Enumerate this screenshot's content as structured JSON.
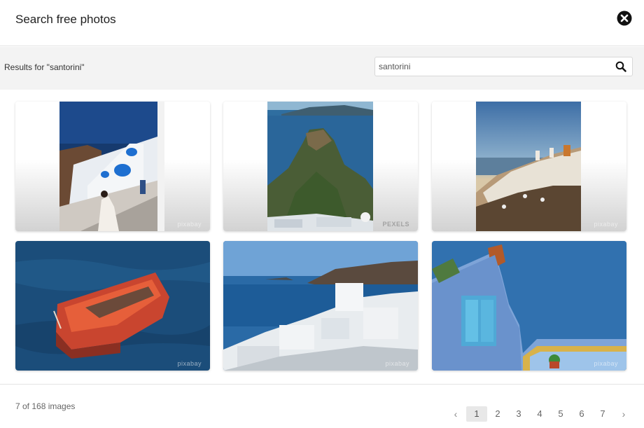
{
  "header": {
    "title": "Search free photos",
    "close_icon": "close-circle-icon"
  },
  "search": {
    "results_label": "Results for \"santorini\"",
    "query": "santorini",
    "search_icon": "search-icon"
  },
  "photos": [
    {
      "description": "Oia blue domes with woman on stairs",
      "watermark": "pixabay",
      "layout": "portrait"
    },
    {
      "description": "Skaros rock with sea and islands",
      "watermark": "PEXELS",
      "layout": "portrait"
    },
    {
      "description": "Oia windmills village at sunset",
      "watermark": "pixabay",
      "layout": "portrait"
    },
    {
      "description": "Red wooden boat on blue sea",
      "watermark": "pixabay",
      "layout": "landscape"
    },
    {
      "description": "White houses and caldera view",
      "watermark": "pixabay",
      "layout": "landscape"
    },
    {
      "description": "Blue wall with blue window over sea",
      "watermark": "pixabay",
      "layout": "landscape"
    }
  ],
  "footer": {
    "count_text": "7 of 168 images",
    "prev_label": "‹",
    "next_label": "›",
    "pages": [
      "1",
      "2",
      "3",
      "4",
      "5",
      "6",
      "7"
    ],
    "active_page": "1"
  }
}
